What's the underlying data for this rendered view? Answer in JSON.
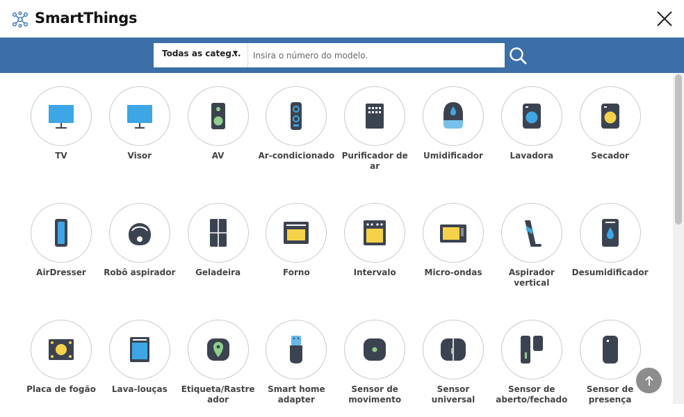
{
  "header": {
    "brand": "SmartThings",
    "close_icon": "close-icon",
    "logo_icon": "smartthings-logo-icon"
  },
  "search": {
    "category_label": "Todas as categ...",
    "category_arrow": "▼",
    "placeholder": "Insira o número do modelo.",
    "value": "",
    "search_icon": "search-icon"
  },
  "colors": {
    "brand_blue": "#3c6fa8",
    "icon_dark": "#3c4350",
    "accent_blue": "#3ea6e4",
    "accent_yellow": "#f6d24a",
    "accent_green": "#8fd08a"
  },
  "devices": [
    {
      "label": "TV",
      "icon": "tv-icon"
    },
    {
      "label": "Visor",
      "icon": "monitor-icon"
    },
    {
      "label": "AV",
      "icon": "speaker-icon"
    },
    {
      "label": "Ar-condicionado",
      "icon": "air-conditioner-icon"
    },
    {
      "label": "Purificador de ar",
      "icon": "air-purifier-icon"
    },
    {
      "label": "Umidificador",
      "icon": "humidifier-icon"
    },
    {
      "label": "Lavadora",
      "icon": "washer-icon"
    },
    {
      "label": "Secador",
      "icon": "dryer-icon"
    },
    {
      "label": "AirDresser",
      "icon": "airdresser-icon"
    },
    {
      "label": "Robô aspirador",
      "icon": "robot-vacuum-icon"
    },
    {
      "label": "Geladeira",
      "icon": "refrigerator-icon"
    },
    {
      "label": "Forno",
      "icon": "oven-icon"
    },
    {
      "label": "Intervalo",
      "icon": "range-icon"
    },
    {
      "label": "Micro-ondas",
      "icon": "microwave-icon"
    },
    {
      "label": "Aspirador vertical",
      "icon": "stick-vacuum-icon"
    },
    {
      "label": "Desumidificador",
      "icon": "dehumidifier-icon"
    },
    {
      "label": "Placa de fogão",
      "icon": "cooktop-icon"
    },
    {
      "label": "Lava-louças",
      "icon": "dishwasher-icon"
    },
    {
      "label": "Etiqueta/Rastreador",
      "icon": "tracker-icon"
    },
    {
      "label": "Smart home adapter",
      "icon": "usb-adapter-icon"
    },
    {
      "label": "Sensor de movimento",
      "icon": "motion-sensor-icon"
    },
    {
      "label": "Sensor universal",
      "icon": "multipurpose-sensor-icon"
    },
    {
      "label": "Sensor de aberto/fechado",
      "icon": "contact-sensor-icon"
    },
    {
      "label": "Sensor de presença",
      "icon": "presence-sensor-icon"
    }
  ],
  "scroll_top_icon": "arrow-up-icon"
}
